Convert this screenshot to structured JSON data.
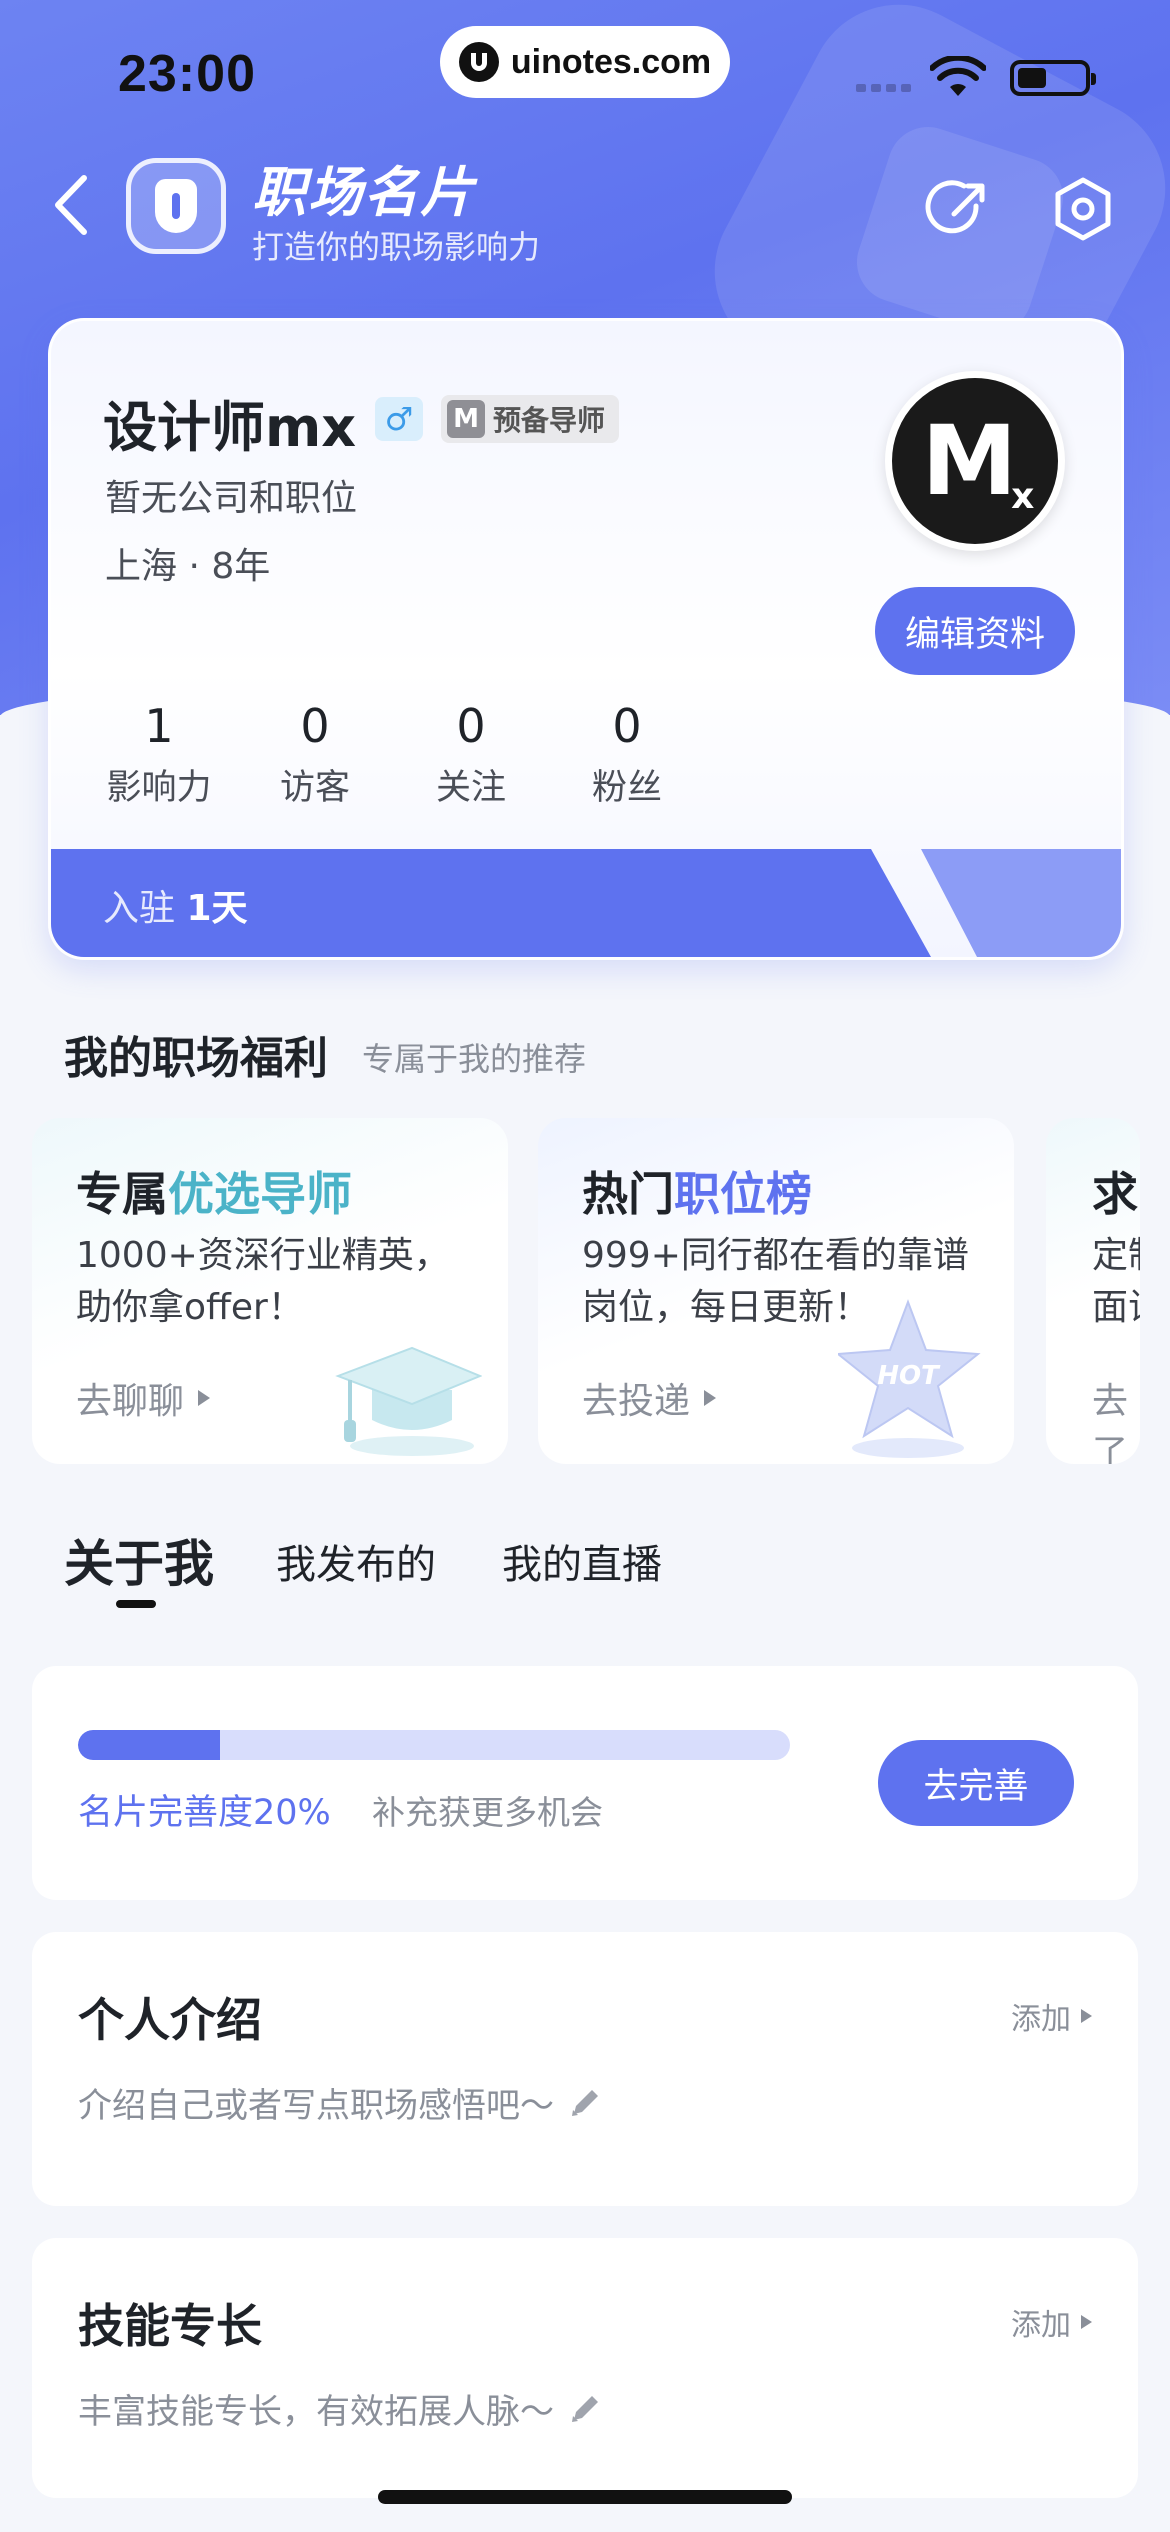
{
  "status_bar": {
    "time": "23:00",
    "watermark": "uinotes.com"
  },
  "header": {
    "title": "职场名片",
    "subtitle": "打造你的职场影响力"
  },
  "profile": {
    "name": "设计师mx",
    "gender_symbol": "♂",
    "badge_icon": "M",
    "badge_label": "预备导师",
    "company": "暂无公司和职位",
    "location": "上海 · 8年",
    "avatar_text": "M",
    "avatar_subtext": "x",
    "edit_button": "编辑资料",
    "stats": [
      {
        "value": "1",
        "label": "影响力"
      },
      {
        "value": "0",
        "label": "访客"
      },
      {
        "value": "0",
        "label": "关注"
      },
      {
        "value": "0",
        "label": "粉丝"
      }
    ],
    "joined_prefix": "入驻",
    "joined_days": "1天"
  },
  "benefits": {
    "title": "我的职场福利",
    "subtitle": "专属于我的推荐",
    "cards": [
      {
        "title_plain": "专属",
        "title_highlight": "优选导师",
        "desc": "1000+资深行业精英，助你拿offer！",
        "action": "去聊聊",
        "icon": "graduation-cap-icon"
      },
      {
        "title_plain": "热门",
        "title_highlight": "职位榜",
        "desc": "999+同行都在看的靠谱岗位，每日更新！",
        "action": "去投递",
        "icon": "hot-star-icon",
        "icon_text": "HOT"
      },
      {
        "title_plain": "求",
        "title_highlight": "",
        "desc": "定制\n面试",
        "action": "去了"
      }
    ]
  },
  "tabs": [
    {
      "label": "关于我",
      "active": true
    },
    {
      "label": "我发布的",
      "active": false
    },
    {
      "label": "我的直播",
      "active": false
    }
  ],
  "completeness": {
    "percent": 20,
    "label": "名片完善度20%",
    "hint": "补充获更多机会",
    "button": "去完善"
  },
  "intro": {
    "title": "个人介绍",
    "add_label": "添加",
    "hint": "介绍自己或者写点职场感悟吧～"
  },
  "skills": {
    "title": "技能专长",
    "add_label": "添加",
    "hint": "丰富技能专长，有效拓展人脉～"
  },
  "colors": {
    "accent": "#5e72ef",
    "teal": "#4bb3c8",
    "background": "#f4f6fb"
  }
}
